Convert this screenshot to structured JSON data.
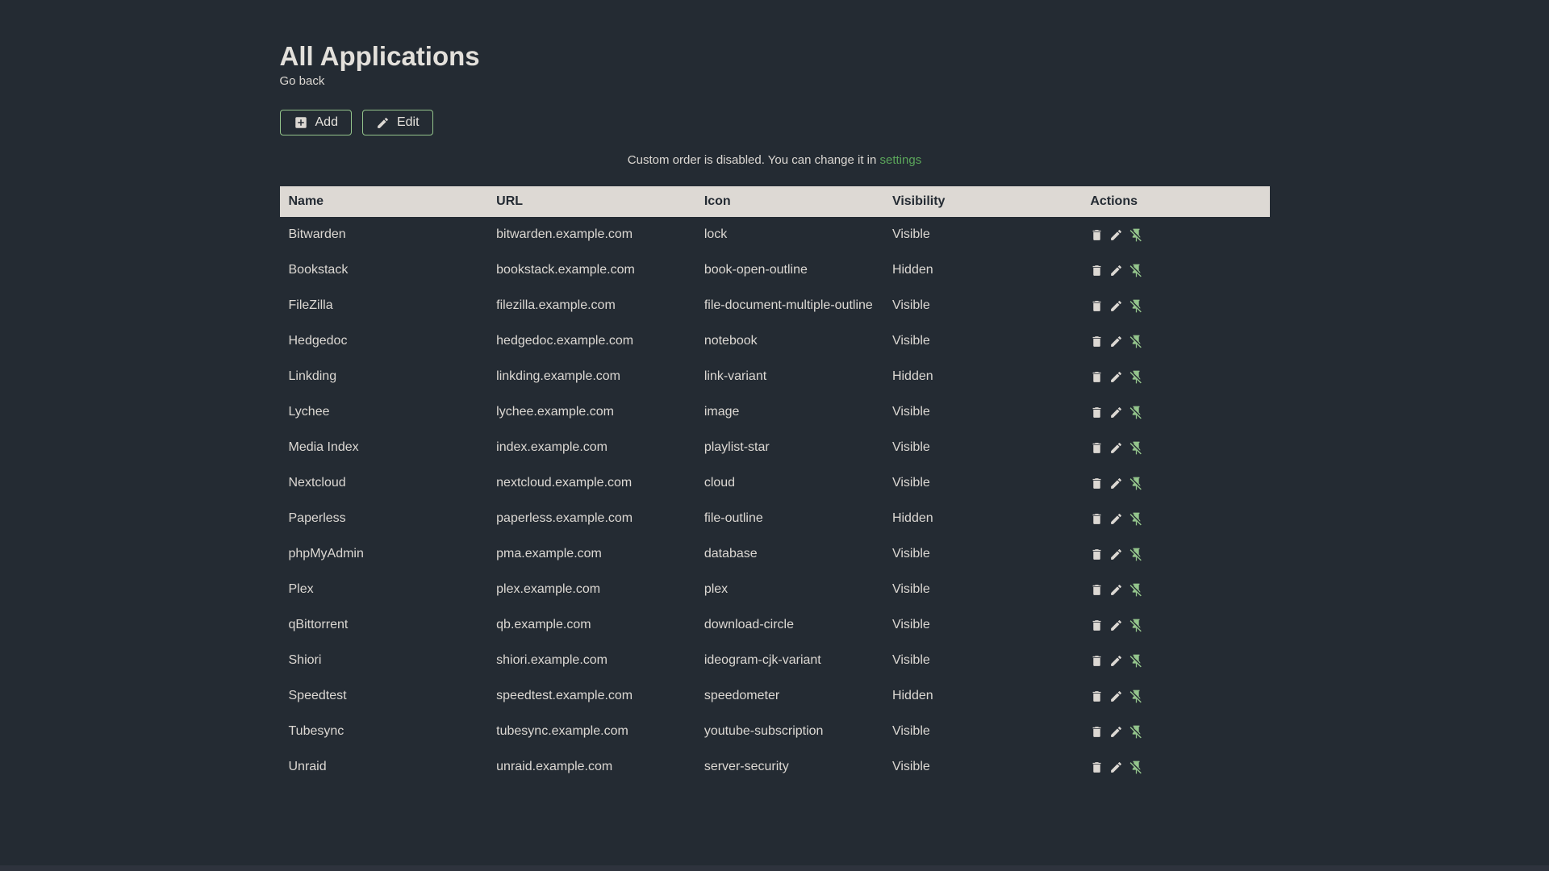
{
  "page": {
    "title": "All Applications",
    "back_link": "Go back"
  },
  "toolbar": {
    "add_label": "Add",
    "edit_label": "Edit"
  },
  "notice": {
    "text": "Custom order is disabled. You can change it in ",
    "link_label": "settings"
  },
  "colors": {
    "background": "#242b33",
    "primary_text": "#dcd8d3",
    "header_bg": "#ddd9d4",
    "header_text": "#242b33",
    "accent_green": "#94c58c",
    "link_green": "#5ba65b"
  },
  "table": {
    "headers": [
      "Name",
      "URL",
      "Icon",
      "Visibility",
      "Actions"
    ],
    "action_icons": [
      "delete-icon",
      "pencil-icon",
      "pin-off-icon"
    ],
    "rows": [
      {
        "name": "Bitwarden",
        "url": "bitwarden.example.com",
        "icon": "lock",
        "visibility": "Visible"
      },
      {
        "name": "Bookstack",
        "url": "bookstack.example.com",
        "icon": "book-open-outline",
        "visibility": "Hidden"
      },
      {
        "name": "FileZilla",
        "url": "filezilla.example.com",
        "icon": "file-document-multiple-outline",
        "visibility": "Visible"
      },
      {
        "name": "Hedgedoc",
        "url": "hedgedoc.example.com",
        "icon": "notebook",
        "visibility": "Visible"
      },
      {
        "name": "Linkding",
        "url": "linkding.example.com",
        "icon": "link-variant",
        "visibility": "Hidden"
      },
      {
        "name": "Lychee",
        "url": "lychee.example.com",
        "icon": "image",
        "visibility": "Visible"
      },
      {
        "name": "Media Index",
        "url": "index.example.com",
        "icon": "playlist-star",
        "visibility": "Visible"
      },
      {
        "name": "Nextcloud",
        "url": "nextcloud.example.com",
        "icon": "cloud",
        "visibility": "Visible"
      },
      {
        "name": "Paperless",
        "url": "paperless.example.com",
        "icon": "file-outline",
        "visibility": "Hidden"
      },
      {
        "name": "phpMyAdmin",
        "url": "pma.example.com",
        "icon": "database",
        "visibility": "Visible"
      },
      {
        "name": "Plex",
        "url": "plex.example.com",
        "icon": "plex",
        "visibility": "Visible"
      },
      {
        "name": "qBittorrent",
        "url": "qb.example.com",
        "icon": "download-circle",
        "visibility": "Visible"
      },
      {
        "name": "Shiori",
        "url": "shiori.example.com",
        "icon": "ideogram-cjk-variant",
        "visibility": "Visible"
      },
      {
        "name": "Speedtest",
        "url": "speedtest.example.com",
        "icon": "speedometer",
        "visibility": "Hidden"
      },
      {
        "name": "Tubesync",
        "url": "tubesync.example.com",
        "icon": "youtube-subscription",
        "visibility": "Visible"
      },
      {
        "name": "Unraid",
        "url": "unraid.example.com",
        "icon": "server-security",
        "visibility": "Visible"
      }
    ]
  }
}
